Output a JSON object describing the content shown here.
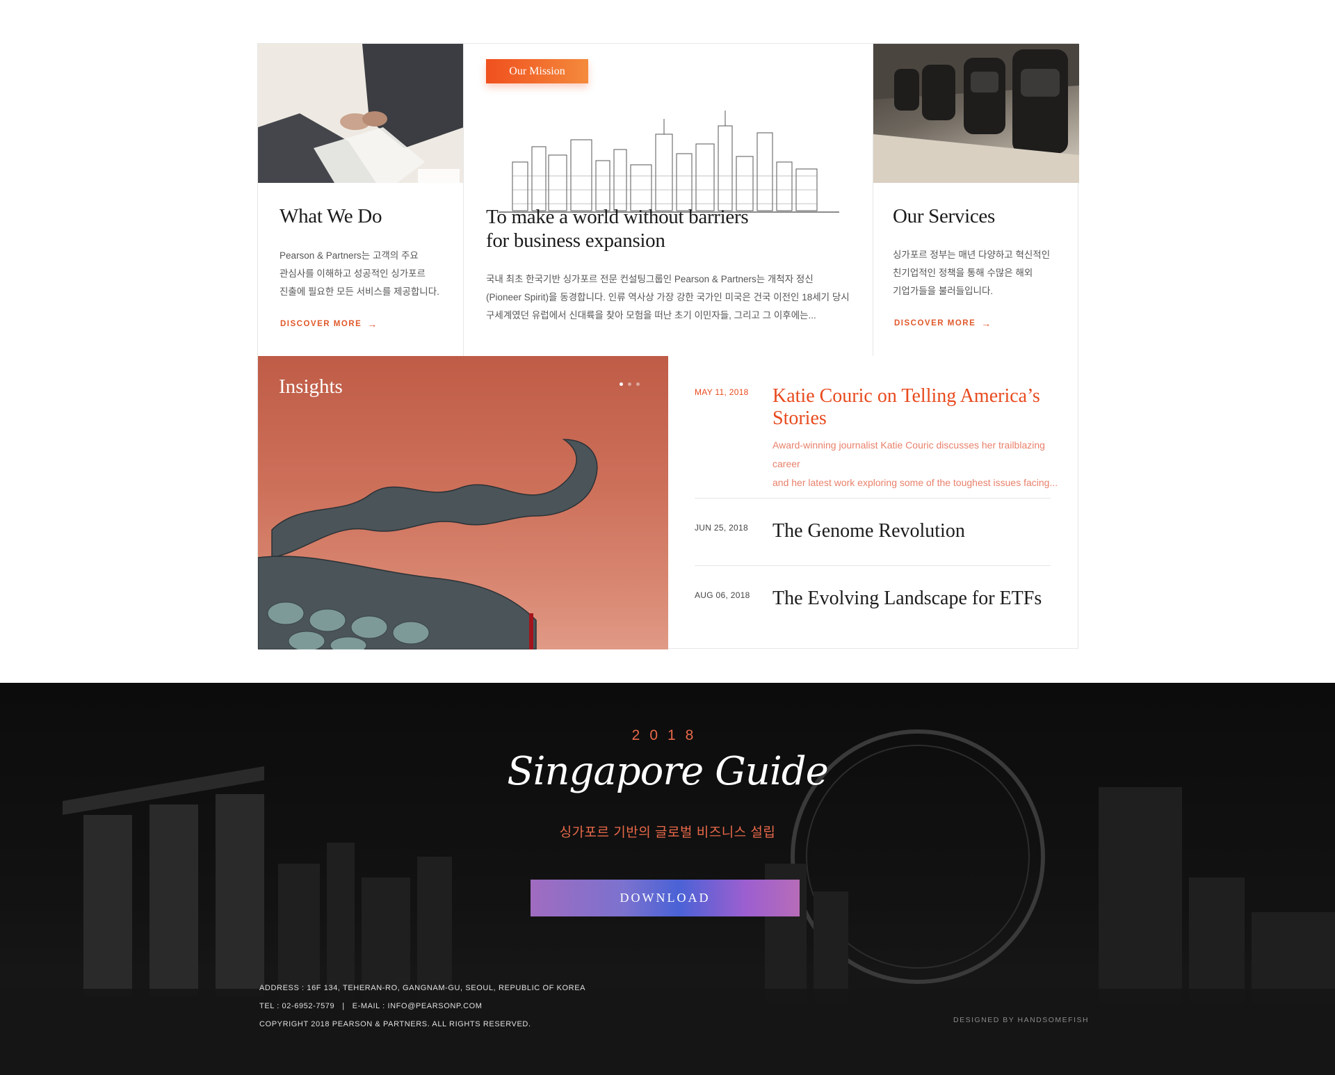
{
  "what_we_do": {
    "title": "What We Do",
    "body_lines": [
      "Pearson & Partners는 고객의 주요",
      "관심사를 이해하고 성공적인 싱가포르",
      "진출에 필요한 모든 서비스를 제공합니다."
    ],
    "discover_label": "DISCOVER MORE"
  },
  "mission": {
    "badge": "Our Mission",
    "title_lines": [
      "To make a world without barriers",
      "for business expansion"
    ],
    "body_lines": [
      "국내 최초 한국기반 싱가포르 전문 컨설팅그룹인 Pearson & Partners는 개척자 정신",
      "(Pioneer Spirit)을 동경합니다. 인류 역사상 가장 강한 국가인 미국은 건국 이전인 18세기 당시",
      "구세계였던 유럽에서 신대륙을 찾아 모험을 떠난 초기 이민자들, 그리고 그 이후에는..."
    ]
  },
  "services": {
    "title": "Our Services",
    "body_lines": [
      "싱가포르 정부는 매년 다양하고 혁신적인",
      "친기업적인 정책을 통해 수많은 해외",
      "기업가들을 불러들입니다."
    ],
    "discover_label": "DISCOVER MORE"
  },
  "insights": {
    "title": "Insights",
    "slide_count": 3,
    "active_slide": 1
  },
  "news": [
    {
      "date": "MAY 11, 2018",
      "title_lines": [
        "Katie Couric on Telling America’s",
        "Stories"
      ],
      "desc_lines": [
        "Award-winning journalist Katie Couric discusses her trailblazing career",
        "and her latest work exploring some of the toughest issues facing..."
      ],
      "highlighted": true
    },
    {
      "date": "JUN 25, 2018",
      "title_lines": [
        "The Genome Revolution"
      ],
      "highlighted": false
    },
    {
      "date": "AUG 06, 2018",
      "title_lines": [
        "The Evolving Landscape for ETFs"
      ],
      "highlighted": false
    }
  ],
  "banner": {
    "year": "2018",
    "title": "Singapore Guide",
    "subtitle": "싱가포르 기반의 글로벌 비즈니스 설립",
    "download_label": "DOWNLOAD"
  },
  "footer": {
    "address": "ADDRESS : 16F 134, TEHERAN-RO, GANGNAM-GU, SEOUL, REPUBLIC OF KOREA",
    "contact": "TEL : 02-6952-7579   |   E-MAIL : INFO@PEARSONP.COM",
    "copyright": "COPYRIGHT 2018 PEARSON & PARTNERS. ALL RIGHTS RESERVED.",
    "designed_by": "DESIGNED BY HANDSOMEFISH"
  },
  "colors": {
    "accent": "#e84a1e",
    "accent_light": "#e9806b",
    "banner_accent": "#e9694a",
    "insights_bg": "#c8654f"
  },
  "icons": [
    "arrow-right-icon",
    "carousel-dot-icon"
  ]
}
